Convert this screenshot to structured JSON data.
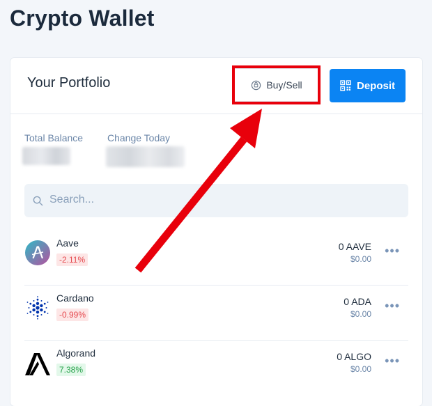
{
  "page": {
    "title": "Crypto Wallet"
  },
  "portfolio": {
    "title": "Your Portfolio",
    "buy_sell_label": "Buy/Sell",
    "deposit_label": "Deposit",
    "total_balance_label": "Total Balance",
    "change_today_label": "Change Today"
  },
  "search": {
    "placeholder": "Search..."
  },
  "assets": [
    {
      "name": "Aave",
      "change": "-2.11%",
      "direction": "negative",
      "amount": "0 AAVE",
      "fiat": "$0.00",
      "icon": "aave-logo-icon"
    },
    {
      "name": "Cardano",
      "change": "-0.99%",
      "direction": "negative",
      "amount": "0 ADA",
      "fiat": "$0.00",
      "icon": "cardano-logo-icon"
    },
    {
      "name": "Algorand",
      "change": "7.38%",
      "direction": "positive",
      "amount": "0 ALGO",
      "fiat": "$0.00",
      "icon": "algorand-logo-icon"
    }
  ],
  "colors": {
    "accent": "#0b84f3",
    "annotation": "#e8000b",
    "negative": "#e5484d",
    "positive": "#24a148"
  }
}
